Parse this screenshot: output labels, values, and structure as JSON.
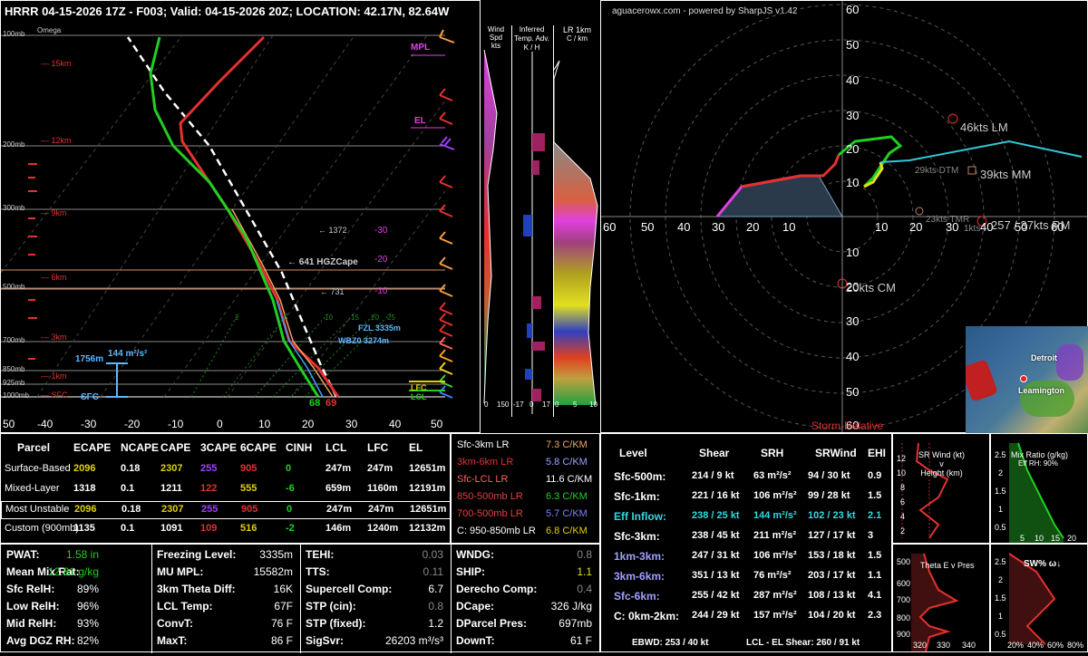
{
  "header": {
    "title": "HRRR 04-15-2026 17Z - F003; Valid: 04-15-2026 20Z; LOCATION: 42.17N, 82.64W",
    "hodo_title": "aguacerowx.com - powered by SharpJS v1.42"
  },
  "skewt": {
    "pressure_labels": [
      "100mb",
      "200mb",
      "300mb",
      "500mb",
      "700mb",
      "850mb",
      "925mb",
      "1000mb"
    ],
    "height_labels": [
      "15km",
      "12km",
      "9km",
      "6km",
      "3km",
      "1km",
      "SFC"
    ],
    "temp_ticks": [
      "50",
      "-40",
      "-30",
      "-20",
      "-10",
      "0",
      "10",
      "20",
      "30",
      "40",
      "50"
    ],
    "omega_label": "Omega",
    "annotations": {
      "mpl": "MPL",
      "el": "EL",
      "lfc": "LFC",
      "lcl": "LCL",
      "fzl": "FZL 3335m",
      "wbz": "WBZ0 3274m",
      "hgz": "← 641 HGZCape",
      "a1372": "← 1372",
      "a731": "← 731",
      "m30": "-30",
      "m20": "-20",
      "m10": "-10",
      "srh_label": "1756m",
      "srh_val": "144 m²/s²",
      "sfc": "SFC",
      "t68": "68",
      "t69": "69"
    },
    "mixing_ticks": [
      "2",
      "5",
      "10",
      "15",
      "20",
      "25"
    ]
  },
  "side_panels": {
    "wind_title": "Wind Spd",
    "wind_unit": "kts",
    "wind_axis": [
      "0",
      "150"
    ],
    "adv_title": "Inferred Temp. Adv.",
    "adv_unit": "K / H",
    "adv_axis": [
      "-17",
      "0",
      "17"
    ],
    "lr_title": "LR 1km",
    "lr_unit": "C / km",
    "lr_axis": [
      "0",
      "5",
      "10"
    ]
  },
  "hodograph": {
    "ring_labels": [
      "10",
      "20",
      "30",
      "40",
      "50",
      "60"
    ],
    "axis_labels": [
      "60",
      "50",
      "40",
      "30",
      "20",
      "10",
      "10",
      "20",
      "30",
      "40",
      "50",
      "60"
    ],
    "lm": "46kts LM",
    "mm": "39kts MM",
    "rm": "257 / 37kts RM",
    "cm": "20kts CM",
    "dtm": "29kts DTM",
    "tmr": "23kts TMR",
    "okts": "1kts",
    "footer": "Storm-Relative",
    "map_labels": [
      "Detroit",
      "Leamington"
    ]
  },
  "parcels": {
    "headers": [
      "Parcel",
      "ECAPE",
      "NCAPE",
      "CAPE",
      "3CAPE",
      "6CAPE",
      "CINH",
      "LCL",
      "LFC",
      "EL"
    ],
    "rows": [
      [
        "Surface-Based",
        "2096",
        "0.18",
        "2307",
        "255",
        "905",
        "0",
        "247m",
        "247m",
        "12651m"
      ],
      [
        "Mixed-Layer",
        "1318",
        "0.1",
        "1211",
        "122",
        "555",
        "-6",
        "659m",
        "1160m",
        "12191m"
      ],
      [
        "Most Unstable",
        "2096",
        "0.18",
        "2307",
        "255",
        "905",
        "0",
        "247m",
        "247m",
        "12651m"
      ],
      [
        "Custom (900mb)",
        "1135",
        "0.1",
        "1091",
        "109",
        "516",
        "-2",
        "146m",
        "1240m",
        "12132m"
      ]
    ]
  },
  "lapse": {
    "rows": [
      [
        "Sfc-3km LR",
        "7.3 C/KM"
      ],
      [
        "3km-6km LR",
        "5.8 C/KM"
      ],
      [
        "Sfc-LCL LR",
        "11.6 C/KM"
      ],
      [
        "850-500mb LR",
        "6.3 C/KM"
      ],
      [
        "700-500mb LR",
        "5.7 C/KM"
      ],
      [
        "C: 950-850mb LR",
        "6.8 C/KM"
      ]
    ]
  },
  "kinematics": {
    "headers": [
      "Level",
      "Shear",
      "SRH",
      "SRWind",
      "EHI"
    ],
    "rows": [
      [
        "Sfc-500m:",
        "214 / 9 kt",
        "63 m²/s²",
        "94 / 30 kt",
        "0.9"
      ],
      [
        "Sfc-1km:",
        "221 / 16 kt",
        "106 m²/s²",
        "99 / 28 kt",
        "1.5"
      ],
      [
        "Eff Inflow:",
        "238 / 25 kt",
        "144 m²/s²",
        "102 / 23 kt",
        "2.1"
      ],
      [
        "Sfc-3km:",
        "238 / 45 kt",
        "211 m²/s²",
        "127 / 17 kt",
        "3"
      ],
      [
        "1km-3km:",
        "247 / 31 kt",
        "106 m²/s²",
        "153 / 18 kt",
        "1.5"
      ],
      [
        "3km-6km:",
        "351 / 13 kt",
        "76 m²/s²",
        "203 / 17 kt",
        "1.1"
      ],
      [
        "Sfc-6km:",
        "255 / 42 kt",
        "287 m²/s²",
        "108 / 13 kt",
        "4.1"
      ],
      [
        "C: 0km-2km:",
        "244 / 29 kt",
        "157 m²/s²",
        "104 / 20 kt",
        "2.3"
      ]
    ],
    "ebwd": "EBWD: 253 / 40 kt",
    "lcl_el": "LCL - EL Shear:   260 / 91 kt"
  },
  "thermo": {
    "col1": [
      [
        "PWAT:",
        "1.58 in"
      ],
      [
        "Mean Mix Rat:",
        "12.81 g/kg"
      ],
      [
        "Sfc RelH:",
        "89%"
      ],
      [
        "Low RelH:",
        "96%"
      ],
      [
        "Mid RelH:",
        "93%"
      ],
      [
        "Avg DGZ RH:",
        "82%"
      ]
    ],
    "col2": [
      [
        "Freezing Level:",
        "3335m"
      ],
      [
        "MU MPL:",
        "15582m"
      ],
      [
        "3km Theta Diff:",
        "16K"
      ],
      [
        "LCL Temp:",
        "67F"
      ],
      [
        "ConvT:",
        "76 F"
      ],
      [
        "MaxT:",
        "86 F"
      ]
    ],
    "col3": [
      [
        "TEHI:",
        "0.03"
      ],
      [
        "TTS:",
        "0.11"
      ],
      [
        "Supercell Comp:",
        "6.7"
      ],
      [
        "STP (cin):",
        "0.8"
      ],
      [
        "STP (fixed):",
        "1.2"
      ],
      [
        "SigSvr:",
        "26203 m³/s³"
      ]
    ],
    "col4": [
      [
        "WNDG:",
        "0.8"
      ],
      [
        "SHIP:",
        "1.1"
      ],
      [
        "Derecho Comp:",
        "0.4"
      ],
      [
        "DCape:",
        "326 J/kg"
      ],
      [
        "DParcel Pres:",
        "697mb"
      ],
      [
        "DownT:",
        "61 F"
      ]
    ]
  },
  "mini": {
    "srwind_title": "SR Wind (kt)\nv\nHeight (km)",
    "srwind_y": [
      "12",
      "10",
      "8",
      "6",
      "4",
      "2"
    ],
    "srwind_x": [
      "0",
      "20",
      "40",
      "60"
    ],
    "mixr_title": "Mix Ratio (g/kg)",
    "mixr_sub": "Eff RH: 90%",
    "mixr_y": [
      "2.5",
      "2",
      "1.5",
      "1",
      "0.5"
    ],
    "mixr_x": [
      "5",
      "10",
      "15",
      "20"
    ],
    "theta_title": "Theta E v Pres",
    "theta_y": [
      "500",
      "600",
      "700",
      "800",
      "900"
    ],
    "theta_x": [
      "320",
      "330",
      "340"
    ],
    "sw_title": "SW% ω↓",
    "sw_y": [
      "2.5",
      "2",
      "1.5",
      "1",
      "0.5"
    ],
    "sw_x": [
      "20%",
      "40%",
      "60%",
      "80%"
    ]
  }
}
